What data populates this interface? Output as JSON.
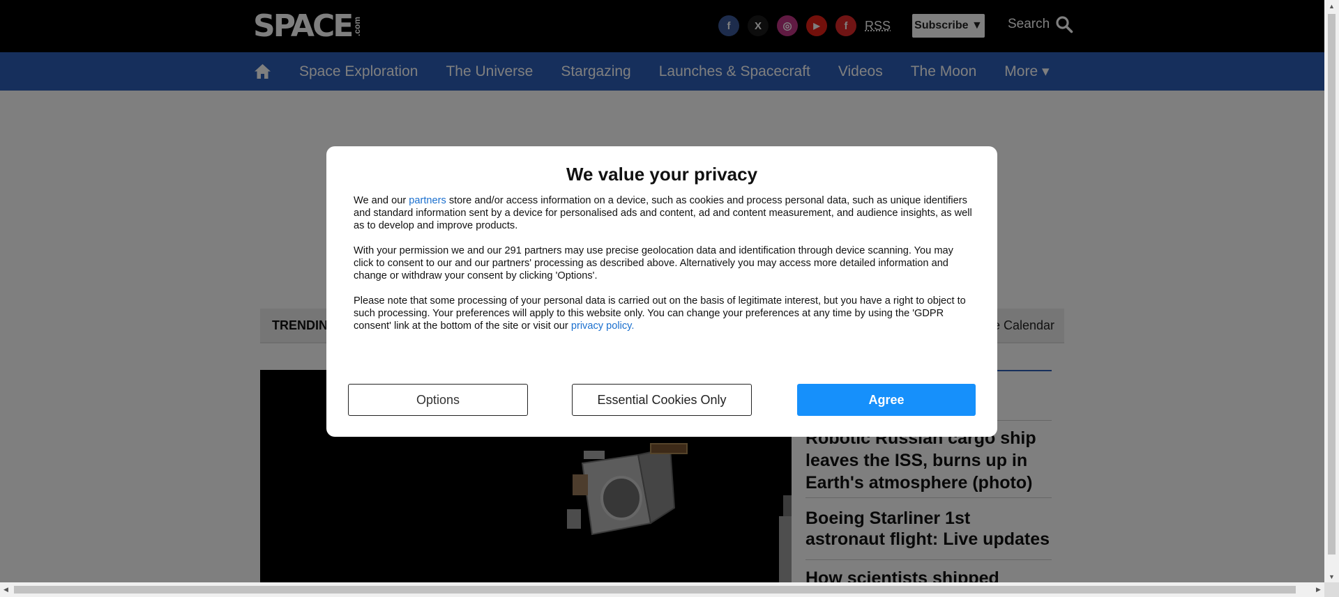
{
  "site": {
    "logo_main": "SPACE",
    "logo_suffix": ".com"
  },
  "header": {
    "socials": [
      {
        "name": "facebook-icon",
        "glyph": "f",
        "color": "#3b5998"
      },
      {
        "name": "x-twitter-icon",
        "glyph": "X",
        "color": "#1a1a1a"
      },
      {
        "name": "instagram-icon",
        "glyph": "◎",
        "color": "#c13584"
      },
      {
        "name": "youtube-icon",
        "glyph": "▶",
        "color": "#e62117"
      },
      {
        "name": "flipboard-icon",
        "glyph": "f",
        "color": "#e12828"
      }
    ],
    "rss_label": "RSS",
    "subscribe_label": "Subscribe ▼",
    "search_label": "Search"
  },
  "nav": {
    "items": [
      "Space Exploration",
      "The Universe",
      "Stargazing",
      "Launches & Spacecraft",
      "Videos",
      "The Moon",
      "More ▾"
    ]
  },
  "trending": {
    "label": "TRENDIN",
    "right_text": "e Calendar"
  },
  "sidebar": {
    "items": [
      "Robotic Russian cargo ship leaves the ISS, burns up in Earth's atmosphere (photo)",
      "Boeing Starliner 1st astronaut flight: Live updates",
      "How scientists shipped"
    ]
  },
  "consent": {
    "title": "We value your privacy",
    "p1_before": "We and our ",
    "p1_link": "partners",
    "p1_after": " store and/or access information on a device, such as cookies and process personal data, such as unique identifiers and standard information sent by a device for personalised ads and content, ad and content measurement, and audience insights, as well as to develop and improve products.",
    "p2": "With your permission we and our 291 partners may use precise geolocation data and identification through device scanning. You may click to consent to our and our partners' processing as described above. Alternatively you may access more detailed information and change or withdraw your consent by clicking 'Options'.",
    "p3_before": "Please note that some processing of your personal data is carried out on the basis of legitimate interest, but you have a right to object to such processing. Your preferences will apply to this website only. You can change your preferences at any time by using the 'GDPR consent' link at the bottom of the site or visit our ",
    "p3_link": "privacy policy.",
    "options_label": "Options",
    "essential_label": "Essential Cookies Only",
    "agree_label": "Agree"
  },
  "colors": {
    "nav_bg": "#2c5eb8",
    "agree_bg": "#1690fb",
    "link": "#1a6fce"
  }
}
